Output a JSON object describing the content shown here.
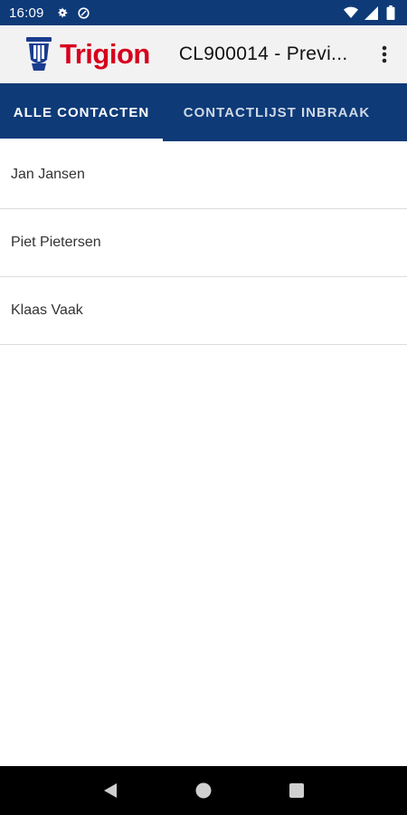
{
  "status_bar": {
    "time": "16:09",
    "left_icons": [
      "gear-icon",
      "data-saver-icon"
    ],
    "right_icons": [
      "wifi-icon",
      "signal-icon",
      "battery-icon"
    ]
  },
  "app_bar": {
    "logo_text": "Trigion",
    "title": "CL900014 - Previ...",
    "overflow_icon": "more-vert-icon"
  },
  "tabs": [
    {
      "label": "ALLE CONTACTEN",
      "selected": true
    },
    {
      "label": "CONTACTLIJST INBRAAK",
      "selected": false
    }
  ],
  "contacts": [
    {
      "name": "Jan Jansen"
    },
    {
      "name": "Piet Pietersen"
    },
    {
      "name": "Klaas Vaak"
    }
  ],
  "nav_bar": {
    "buttons": [
      "back-icon",
      "home-icon",
      "recents-icon"
    ]
  },
  "colors": {
    "primary": "#0e3a78",
    "brand_red": "#d6001c",
    "app_bar_bg": "#f2f2f2"
  }
}
